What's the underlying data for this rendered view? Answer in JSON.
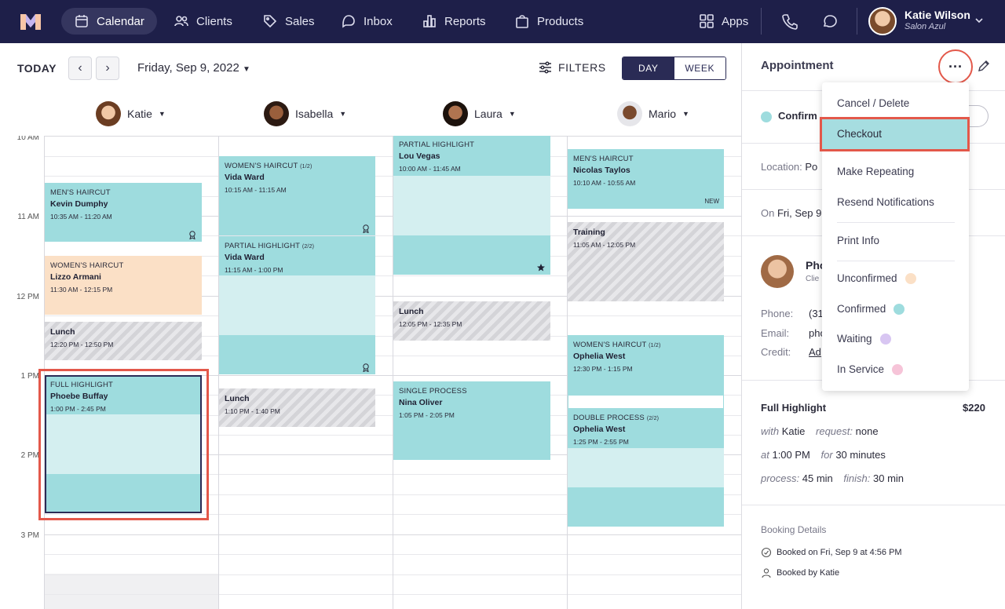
{
  "nav": {
    "items": [
      {
        "label": "Calendar",
        "icon": "calendar-icon",
        "active": true
      },
      {
        "label": "Clients",
        "icon": "clients-icon"
      },
      {
        "label": "Sales",
        "icon": "tag-icon"
      },
      {
        "label": "Inbox",
        "icon": "inbox-icon"
      },
      {
        "label": "Reports",
        "icon": "bar-chart-icon"
      },
      {
        "label": "Products",
        "icon": "bag-icon"
      }
    ],
    "apps_label": "Apps",
    "user": {
      "name": "Katie Wilson",
      "salon": "Salon Azul"
    }
  },
  "toolbar": {
    "today": "TODAY",
    "prev": "‹",
    "next": "›",
    "date": "Friday, Sep 9, 2022",
    "filters": "FILTERS",
    "view_day": "DAY",
    "view_week": "WEEK"
  },
  "staff": [
    "Katie",
    "Isabella",
    "Laura",
    "Mario"
  ],
  "times": [
    "10 AM",
    "11 AM",
    "12 PM",
    "1 PM",
    "2 PM",
    "3 PM"
  ],
  "appointments": {
    "katie": [
      {
        "service": "MEN'S HAIRCUT",
        "client": "Kevin Dumphy",
        "time": "10:35 AM - 11:20 AM"
      },
      {
        "service": "WOMEN'S HAIRCUT",
        "client": "Lizzo Armani",
        "time": "11:30 AM - 12:15 PM"
      },
      {
        "service": "",
        "client": "Lunch",
        "time": "12:20 PM - 12:50 PM"
      },
      {
        "service": "FULL HIGHLIGHT",
        "client": "Phoebe Buffay",
        "time": "1:00 PM - 2:45 PM"
      }
    ],
    "isabella": [
      {
        "service": "WOMEN'S HAIRCUT",
        "part": "(1/2)",
        "client": "Vida Ward",
        "time": "10:15 AM - 11:15 AM"
      },
      {
        "service": "PARTIAL HIGHLIGHT",
        "part": "(2/2)",
        "client": "Vida Ward",
        "time": "11:15 AM - 1:00 PM"
      },
      {
        "service": "",
        "client": "Lunch",
        "time": "1:10 PM - 1:40 PM"
      }
    ],
    "laura": [
      {
        "service": "PARTIAL HIGHLIGHT",
        "client": "Lou Vegas",
        "time": "10:00 AM - 11:45 AM"
      },
      {
        "service": "",
        "client": "Lunch",
        "time": "12:05 PM - 12:35 PM"
      },
      {
        "service": "SINGLE PROCESS",
        "client": "Nina Oliver",
        "time": "1:05 PM - 2:05 PM"
      }
    ],
    "mario": [
      {
        "service": "MEN'S HAIRCUT",
        "client": "Nicolas Taylos",
        "time": "10:10 AM - 10:55 AM",
        "tag": "NEW"
      },
      {
        "service": "",
        "client": "Training",
        "time": "11:05 AM - 12:05 PM"
      },
      {
        "service": "WOMEN'S HAIRCUT",
        "part": "(1/2)",
        "client": "Ophelia West",
        "time": "12:30 PM - 1:15 PM"
      },
      {
        "service": "DOUBLE PROCESS",
        "part": "(2/2)",
        "client": "Ophelia West",
        "time": "1:25 PM - 2:55 PM"
      }
    ]
  },
  "panel": {
    "title": "Appointment",
    "status": "Confirm",
    "location_label": "Location:",
    "location_value": "Po",
    "on_label": "On",
    "on_value": "Fri, Sep 9",
    "client_name": "Pho",
    "client_sub": "Clie",
    "phone_label": "Phone:",
    "phone_value": "(31",
    "email_label": "Email:",
    "email_value": "pho",
    "credit_label": "Credit:",
    "credit_value": "Ad",
    "service": "Full Highlight",
    "price": "$220",
    "with_label": "with",
    "with_value": "Katie",
    "request_label": "request:",
    "request_value": "none",
    "at_label": "at",
    "at_value": "1:00 PM",
    "for_label": "for",
    "for_value": "30 minutes",
    "process_label": "process:",
    "process_value": "45 min",
    "finish_label": "finish:",
    "finish_value": "30 min",
    "booking_title": "Booking Details",
    "booked_on": "Booked on Fri, Sep 9 at 4:56 PM",
    "booked_by": "Booked by Katie"
  },
  "menu": {
    "cancel": "Cancel / Delete",
    "checkout": "Checkout",
    "repeat": "Make Repeating",
    "resend": "Resend Notifications",
    "print": "Print Info",
    "statuses": [
      {
        "label": "Unconfirmed",
        "color": "#fbe0c6"
      },
      {
        "label": "Confirmed",
        "color": "#9edcde"
      },
      {
        "label": "Waiting",
        "color": "#d8c6f2"
      },
      {
        "label": "In Service",
        "color": "#f6c4d8"
      }
    ]
  },
  "colors": {
    "nav_bg": "#1e1f49",
    "teal": "#9edcde",
    "highlight_red": "#e3584a"
  }
}
